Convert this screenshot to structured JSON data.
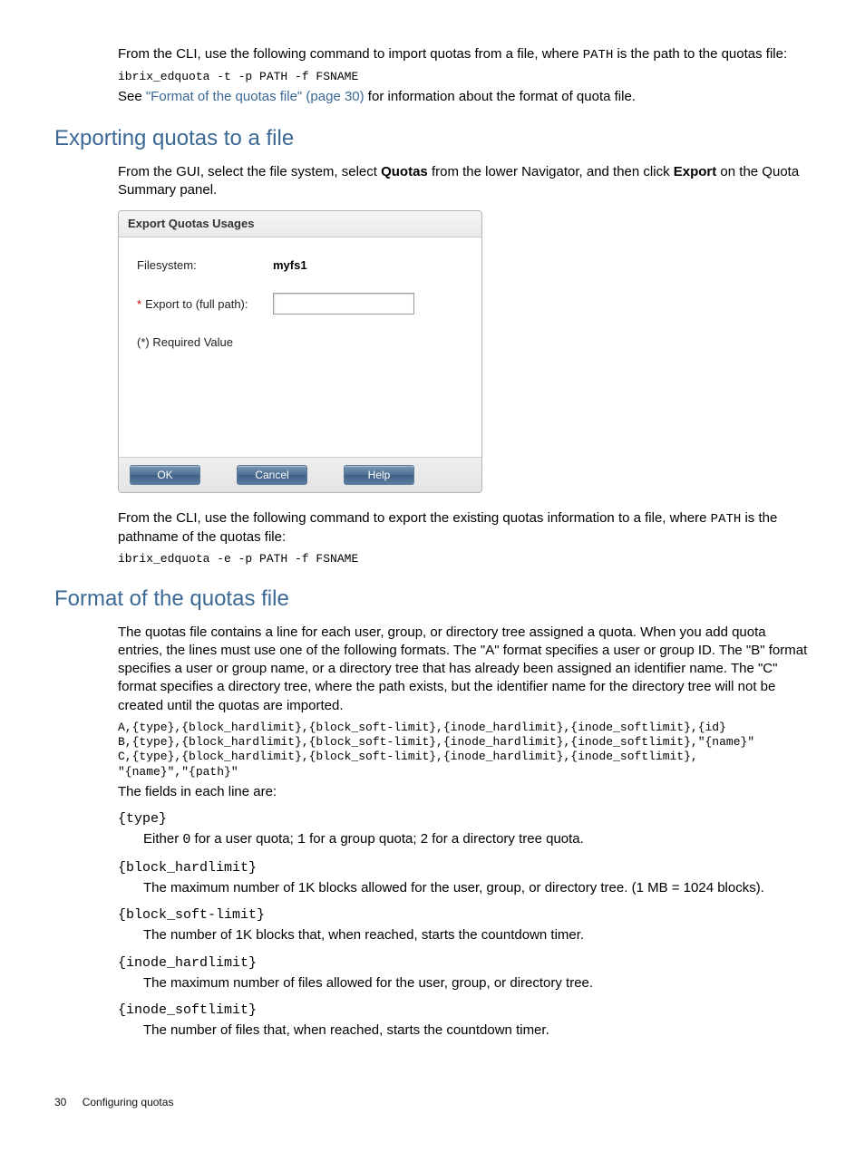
{
  "intro": {
    "p1a": "From the CLI, use the following command to import quotas from a file, where ",
    "p1_path": "PATH",
    "p1b": " is the path to the quotas file:",
    "cmd1": "ibrix_edquota -t -p PATH -f FSNAME",
    "see_a": "See ",
    "see_link": "\"Format of the quotas file\" (page 30)",
    "see_b": " for information about the format of quota file."
  },
  "exporting": {
    "heading": "Exporting quotas to a file",
    "p1a": "From the GUI, select the file system, select ",
    "p1_quotas": "Quotas",
    "p1b": " from the lower Navigator, and then click ",
    "p1_export": "Export",
    "p1c": " on the Quota Summary panel.",
    "p2a": "From the CLI, use the following command to export the existing quotas information to a file, where ",
    "p2_path": "PATH",
    "p2b": " is the pathname of the quotas file:",
    "cmd2": "ibrix_edquota -e -p PATH -f FSNAME"
  },
  "panel": {
    "title": "Export Quotas Usages",
    "fs_label": "Filesystem:",
    "fs_value": "myfs1",
    "export_label": "Export to (full path):",
    "required_note": "(*) Required Value",
    "ok": "OK",
    "cancel": "Cancel",
    "help": "Help"
  },
  "format": {
    "heading": "Format of the quotas file",
    "p1": "The quotas file contains a line for each user, group, or directory tree assigned a quota. When you add quota entries, the lines must use one of the following formats. The \"A\" format specifies a user or group ID. The \"B\" format specifies a user or group name, or a directory tree that has already been assigned an identifier name. The \"C\" format specifies a directory tree, where the path exists, but the identifier name for the directory tree will not be created until the quotas are imported.",
    "code": "A,{type},{block_hardlimit},{block_soft-limit},{inode_hardlimit},{inode_softlimit},{id}\nB,{type},{block_hardlimit},{block_soft-limit},{inode_hardlimit},{inode_softlimit},\"{name}\"\nC,{type},{block_hardlimit},{block_soft-limit},{inode_hardlimit},{inode_softlimit},\n\"{name}\",\"{path}\"",
    "fields_intro": "The fields in each line are:",
    "defs": {
      "type_term": "{type}",
      "type_def_a": "Either ",
      "type_def_0": "0",
      "type_def_b": " for a user quota; ",
      "type_def_1": "1",
      "type_def_c": " for a group quota; 2 for a directory tree quota.",
      "bhl_term": "{block_hardlimit}",
      "bhl_def": "The maximum number of 1K blocks allowed for the user, group, or directory tree. (1 MB = 1024 blocks).",
      "bsl_term": "{block_soft-limit}",
      "bsl_def": "The number of 1K blocks that, when reached, starts the countdown timer.",
      "ihl_term": "{inode_hardlimit}",
      "ihl_def": "The maximum number of files allowed for the user, group, or directory tree.",
      "isl_term": "{inode_softlimit}",
      "isl_def": "The number of files that, when reached, starts the countdown timer."
    }
  },
  "footer": {
    "page": "30",
    "chapter": "Configuring quotas"
  }
}
